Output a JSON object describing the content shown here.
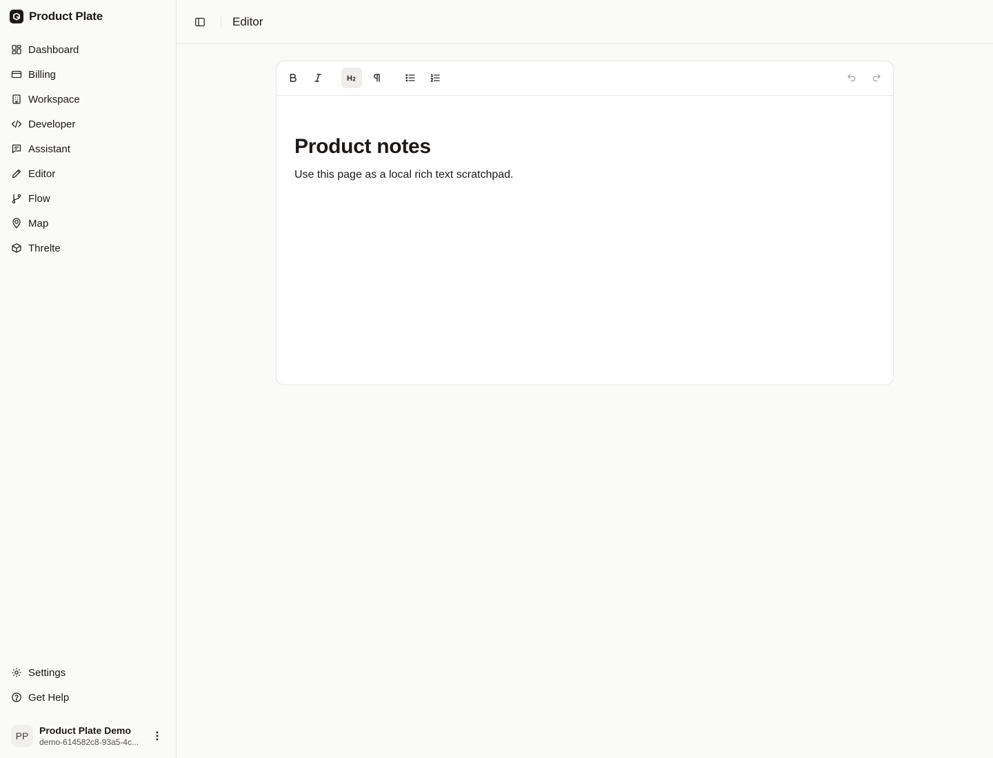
{
  "app": {
    "name": "Product Plate"
  },
  "sidebar": {
    "items": [
      {
        "label": "Dashboard",
        "icon": "dashboard-icon"
      },
      {
        "label": "Billing",
        "icon": "credit-card-icon"
      },
      {
        "label": "Workspace",
        "icon": "building-icon"
      },
      {
        "label": "Developer",
        "icon": "code-icon"
      },
      {
        "label": "Assistant",
        "icon": "message-icon"
      },
      {
        "label": "Editor",
        "icon": "pencil-icon"
      },
      {
        "label": "Flow",
        "icon": "git-branch-icon"
      },
      {
        "label": "Map",
        "icon": "map-pin-user-icon"
      },
      {
        "label": "Threlte",
        "icon": "cube-icon"
      }
    ],
    "footer": [
      {
        "label": "Settings",
        "icon": "gear-icon"
      },
      {
        "label": "Get Help",
        "icon": "help-circle-icon"
      }
    ],
    "user": {
      "initials": "PP",
      "name": "Product Plate Demo",
      "email": "demo-614582c8-93a5-4c..."
    }
  },
  "header": {
    "title": "Editor"
  },
  "editor": {
    "toolbar": [
      {
        "name": "bold",
        "icon": "bold-icon",
        "active": false
      },
      {
        "name": "italic",
        "icon": "italic-icon",
        "active": false
      },
      {
        "name": "heading-2",
        "icon": "heading-2-icon",
        "active": true
      },
      {
        "name": "paragraph",
        "icon": "pilcrow-icon",
        "active": false
      },
      {
        "name": "bullet-list",
        "icon": "bullet-list-icon",
        "active": false
      },
      {
        "name": "ordered-list",
        "icon": "ordered-list-icon",
        "active": false
      },
      {
        "name": "undo",
        "icon": "undo-icon",
        "active": false
      },
      {
        "name": "redo",
        "icon": "redo-icon",
        "active": false
      }
    ],
    "heading": "Product notes",
    "body": "Use this page as a local rich text scratchpad."
  },
  "colors": {
    "background": "#fafaf9",
    "border": "#e7e5e4",
    "text": "#1c1917",
    "active_button": "#efeeec",
    "muted": "#a8a29e"
  }
}
